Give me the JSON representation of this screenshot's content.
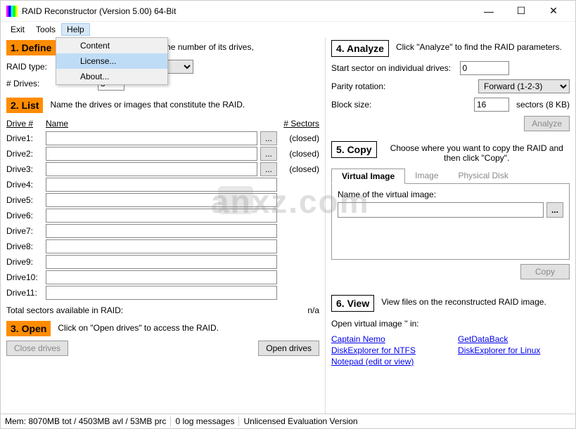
{
  "window": {
    "title": "RAID Reconstructor (Version 5.00) 64-Bit"
  },
  "menu": {
    "items": [
      "Exit",
      "Tools",
      "Help"
    ],
    "dropdown": [
      "Content",
      "License...",
      "About..."
    ]
  },
  "step1": {
    "badge": "1. Define",
    "text": "and the number of its drives,",
    "raid_type_label": "RAID type:",
    "raid_type_value": "",
    "drives_label": "# Drives:",
    "drives_value": "3"
  },
  "step2": {
    "badge": "2. List",
    "text": "Name the drives or images that constitute the RAID.",
    "hdr_drive": "Drive #",
    "hdr_name": "Name",
    "hdr_sectors": "# Sectors",
    "drives": [
      {
        "label": "Drive1:",
        "status": "(closed)",
        "browse": true
      },
      {
        "label": "Drive2:",
        "status": "(closed)",
        "browse": true
      },
      {
        "label": "Drive3:",
        "status": "(closed)",
        "browse": true
      },
      {
        "label": "Drive4:",
        "status": "",
        "browse": false
      },
      {
        "label": "Drive5:",
        "status": "",
        "browse": false
      },
      {
        "label": "Drive6:",
        "status": "",
        "browse": false
      },
      {
        "label": "Drive7:",
        "status": "",
        "browse": false
      },
      {
        "label": "Drive8:",
        "status": "",
        "browse": false
      },
      {
        "label": "Drive9:",
        "status": "",
        "browse": false
      },
      {
        "label": "Drive10:",
        "status": "",
        "browse": false
      },
      {
        "label": "Drive11:",
        "status": "",
        "browse": false
      }
    ],
    "total_label": "Total sectors available in RAID:",
    "total_value": "n/a"
  },
  "step3": {
    "badge": "3. Open",
    "text": "Click on \"Open drives\" to access the RAID.",
    "close_btn": "Close drives",
    "open_btn": "Open drives"
  },
  "step4": {
    "badge": "4. Analyze",
    "text": "Click \"Analyze\" to find the RAID parameters.",
    "start_label": "Start sector on individual drives:",
    "start_value": "0",
    "parity_label": "Parity rotation:",
    "parity_value": "Forward (1-2-3)",
    "block_label": "Block size:",
    "block_value": "16",
    "block_unit": "sectors (8 KB)",
    "analyze_btn": "Analyze"
  },
  "step5": {
    "badge": "5. Copy",
    "text": "Choose where you want to copy the RAID and then click \"Copy\".",
    "tabs": [
      "Virtual Image",
      "Image",
      "Physical Disk"
    ],
    "name_label": "Name of the virtual image:",
    "browse": "...",
    "copy_btn": "Copy"
  },
  "step6": {
    "badge": "6. View",
    "text": "View files on the reconstructed RAID image.",
    "open_label": "Open virtual image '' in:",
    "links_left": [
      "Captain Nemo",
      "DiskExplorer for NTFS",
      "Notepad (edit or view)"
    ],
    "links_right": [
      "GetDataBack",
      "DiskExplorer for Linux"
    ]
  },
  "status": {
    "mem": "Mem: 8070MB tot / 4503MB avl / 53MB prc",
    "log": "0 log messages",
    "lic": "Unlicensed Evaluation Version"
  },
  "watermark": "anxz.com"
}
